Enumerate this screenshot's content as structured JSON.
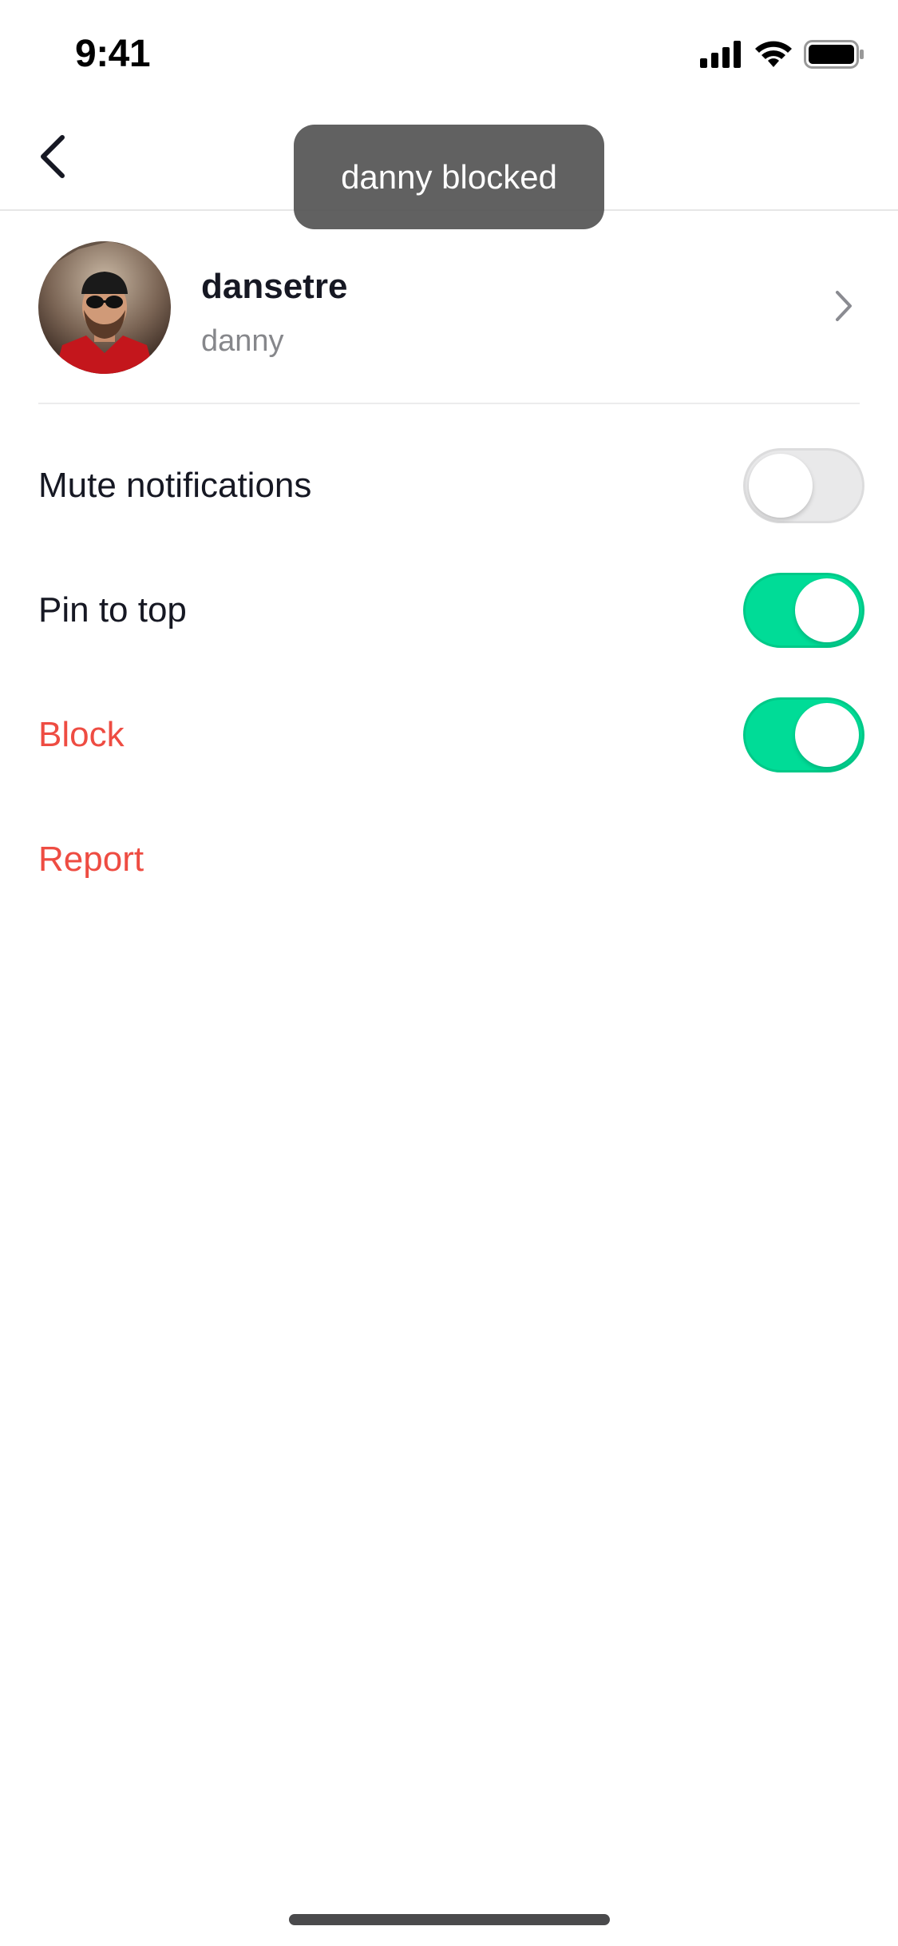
{
  "status_bar": {
    "time": "9:41",
    "icons": [
      "signal-icon",
      "wifi-icon",
      "battery-icon"
    ]
  },
  "nav": {
    "back_icon": "chevron-left-icon"
  },
  "toast": {
    "message": "danny blocked"
  },
  "profile": {
    "username": "dansetre",
    "nickname": "danny",
    "chevron_icon": "chevron-right-icon"
  },
  "settings": {
    "mute": {
      "label": "Mute notifications",
      "enabled": false
    },
    "pin": {
      "label": "Pin to top",
      "enabled": true
    },
    "block": {
      "label": "Block",
      "enabled": true
    },
    "report": {
      "label": "Report"
    }
  },
  "colors": {
    "toggle_on": "#00dc97",
    "toggle_off": "#e9e9ea",
    "danger": "#ee4c42",
    "toast_bg": "#545454"
  }
}
